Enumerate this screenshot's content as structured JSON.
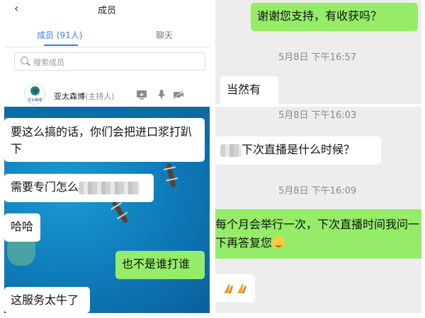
{
  "members_panel": {
    "back_icon": "chevron-left-icon",
    "title": "成员",
    "tab_members": "成员 (91人)",
    "tab_chat": "聊天",
    "search_placeholder": "搜索成员",
    "host": {
      "avatar_text": "亚太森博",
      "name": "亚太森博",
      "role": "(主持人)",
      "icons": [
        "screen-share-icon",
        "microphone-icon",
        "camera-off-icon"
      ]
    },
    "accent_color": "#3b7ddd"
  },
  "left_chat": {
    "messages": [
      {
        "side": "left",
        "text": "要这么搞的话，你们会把进口浆打趴下"
      },
      {
        "side": "left",
        "text": "需要专门怎么",
        "redacted_suffix": true
      },
      {
        "side": "left",
        "text": "哈哈"
      },
      {
        "side": "right",
        "text": "也不是谁打谁"
      },
      {
        "side": "left",
        "text": "这服务太牛了"
      }
    ]
  },
  "right_chat": {
    "msg1": "谢谢您支持，有收获吗？",
    "ts1": "5月8日 下午16:57",
    "msg2": "当然有",
    "ts2": "5月8日 下午16:03",
    "msg3": "下次直播是什么时候？",
    "ts3": "5月8日 下午16:09",
    "msg4": "每个月会举行一次，下次直播时间我问一下再答复您",
    "msg4_emoji": "smile-emoji",
    "msg5_emoji": "folded-hands-emoji",
    "bubble_green": "#95ec69",
    "bubble_white": "#ffffff"
  }
}
